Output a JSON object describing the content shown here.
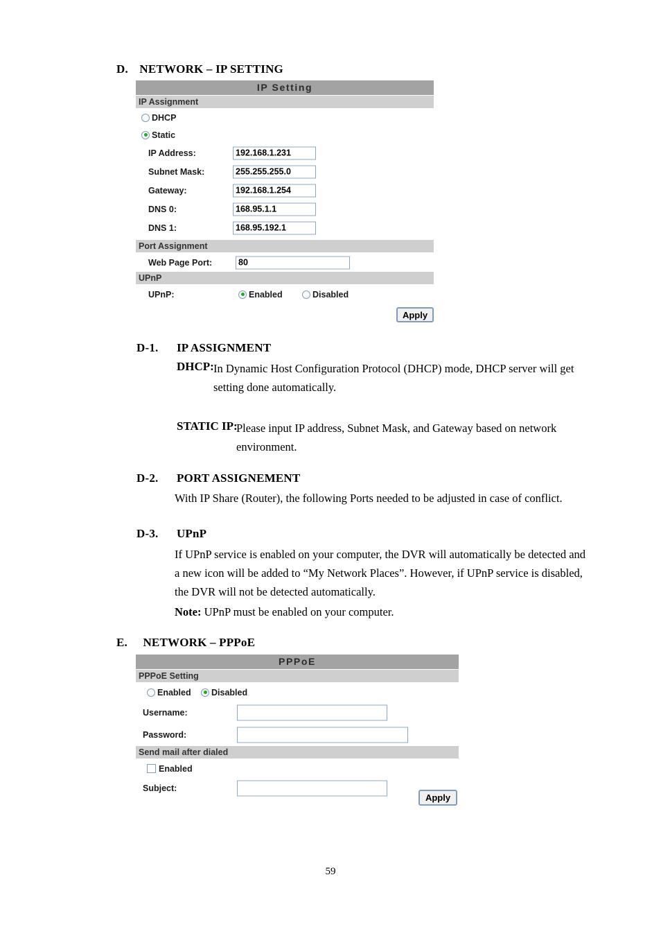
{
  "page": {
    "number": "59"
  },
  "section_d": {
    "marker": "D.",
    "title": "NETWORK – IP SETTING",
    "panel": {
      "title": "IP Setting",
      "ip_assignment_bar": "IP Assignment",
      "mode_options": [
        {
          "label": "DHCP",
          "selected": false
        },
        {
          "label": "Static",
          "selected": true
        }
      ],
      "fields": [
        {
          "label": "IP Address:",
          "value": "192.168.1.231"
        },
        {
          "label": "Subnet Mask:",
          "value": "255.255.255.0"
        },
        {
          "label": "Gateway:",
          "value": "192.168.1.254"
        },
        {
          "label": "DNS 0:",
          "value": "168.95.1.1"
        },
        {
          "label": "DNS 1:",
          "value": "168.95.192.1"
        }
      ],
      "port_assignment_bar": "Port Assignment",
      "web_page_port": {
        "label": "Web Page Port:",
        "value": "80"
      },
      "upnp_bar": "UPnP",
      "upnp_row": {
        "label": "UPnP:",
        "options": [
          {
            "label": "Enabled",
            "selected": true
          },
          {
            "label": "Disabled",
            "selected": false
          }
        ]
      },
      "apply_label": "Apply"
    },
    "d1": {
      "marker": "D-1.",
      "title": "IP ASSIGNMENT",
      "dhcp_label": "DHCP:",
      "dhcp_text": "In Dynamic Host Configuration Protocol (DHCP) mode, DHCP server will get setting done automatically.",
      "static_label": "STATIC IP:",
      "static_text": "Please input IP address, Subnet Mask, and Gateway based on network environment."
    },
    "d2": {
      "marker": "D-2.",
      "title": "PORT ASSIGNEMENT",
      "text": "With IP Share (Router), the following Ports needed to be adjusted in case of conflict."
    },
    "d3": {
      "marker": "D-3.",
      "title": "UPnP",
      "text": "If UPnP service is enabled on your computer, the DVR will automatically be detected and a new icon will be added to “My Network Places”. However, if UPnP service is disabled, the DVR will not be detected automatically.",
      "note_label": "Note:",
      "note_text": "UPnP must be enabled on your computer."
    }
  },
  "section_e": {
    "marker": "E.",
    "title": "NETWORK – PPPoE",
    "panel": {
      "title": "PPPoE",
      "setting_bar": "PPPoE Setting",
      "enable_options": [
        {
          "label": "Enabled",
          "selected": false
        },
        {
          "label": "Disabled",
          "selected": true
        }
      ],
      "fields": [
        {
          "label": "Username:",
          "value": ""
        },
        {
          "label": "Password:",
          "value": ""
        }
      ],
      "sendmail_bar": "Send mail after dialed",
      "sendmail_checkbox": {
        "label": "Enabled",
        "checked": false
      },
      "subject": {
        "label": "Subject:",
        "value": ""
      },
      "apply_label": "Apply"
    }
  },
  "colors": {
    "panel_title_bg": "#a3a3a3",
    "section_bar_bg": "#cfcfcf",
    "field_border": "#8ca7c4",
    "radio_dot": "#18b018"
  }
}
